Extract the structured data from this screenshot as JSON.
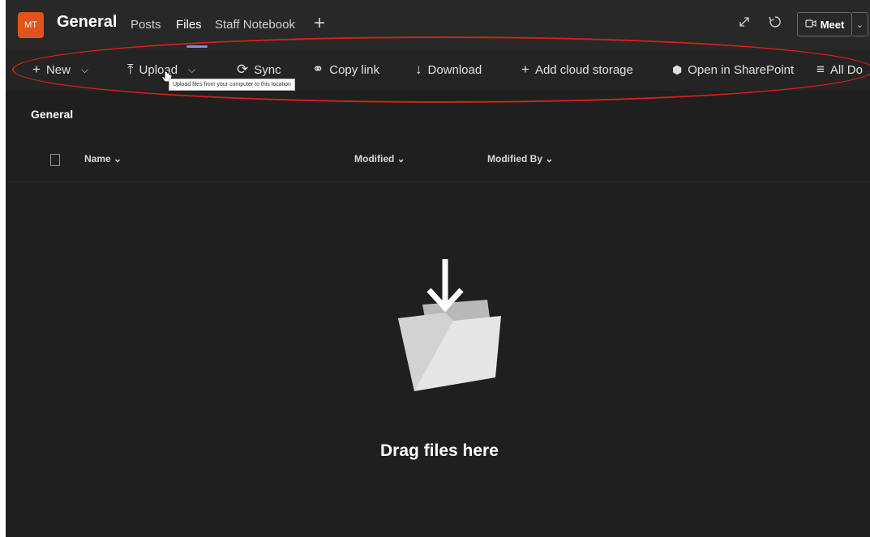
{
  "header": {
    "team_initials": "MT",
    "channel_title": "General",
    "tabs": [
      {
        "label": "Posts",
        "active": false
      },
      {
        "label": "Files",
        "active": true
      },
      {
        "label": "Staff Notebook",
        "active": false
      }
    ],
    "add_tab_glyph": "+",
    "meet_label": "Meet"
  },
  "toolbar": {
    "items": [
      {
        "label": "New",
        "icon": "plus-icon",
        "glyph": "+",
        "has_dropdown": true
      },
      {
        "label": "Upload",
        "icon": "upload-icon",
        "glyph": "⤒",
        "has_dropdown": true
      },
      {
        "label": "Sync",
        "icon": "sync-icon",
        "glyph": "⟳",
        "has_dropdown": false
      },
      {
        "label": "Copy link",
        "icon": "link-icon",
        "glyph": "⚭",
        "has_dropdown": false
      },
      {
        "label": "Download",
        "icon": "download-icon",
        "glyph": "↓",
        "has_dropdown": false
      },
      {
        "label": "Add cloud storage",
        "icon": "plus-icon",
        "glyph": "+",
        "has_dropdown": false
      },
      {
        "label": "Open in SharePoint",
        "icon": "sharepoint-icon",
        "glyph": "⬢",
        "has_dropdown": false
      },
      {
        "label": "All Do",
        "icon": "view-options-icon",
        "glyph": "≡",
        "has_dropdown": false
      }
    ],
    "tooltip": "Upload files from your computer to this location"
  },
  "content": {
    "breadcrumb": "General",
    "columns": {
      "name": "Name",
      "modified": "Modified",
      "modified_by": "Modified By"
    },
    "column_sort_glyph": "⌄",
    "empty_state": "Drag files here"
  },
  "colors": {
    "background": "#1f1f1f",
    "header": "#282828",
    "toolbar": "#242424",
    "team_avatar": "#e2531c",
    "active_tab_indicator": "#8b8cc7",
    "annotation": "#d6201b"
  }
}
